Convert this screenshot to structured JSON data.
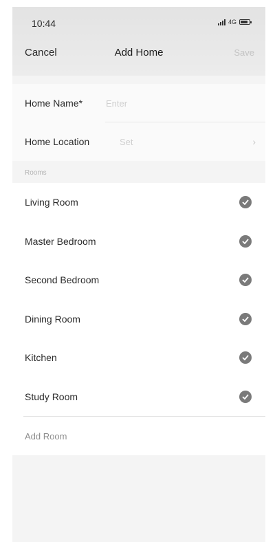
{
  "status_bar": {
    "time": "10:44",
    "network": "4G"
  },
  "nav": {
    "cancel_label": "Cancel",
    "title": "Add Home",
    "save_label": "Save"
  },
  "form": {
    "home_name_label": "Home Name*",
    "home_name_placeholder": "Enter",
    "home_location_label": "Home Location",
    "home_location_value": "Set"
  },
  "rooms": {
    "section_label": "Rooms",
    "items": [
      {
        "label": "Living Room",
        "checked": true
      },
      {
        "label": "Master Bedroom",
        "checked": true
      },
      {
        "label": "Second Bedroom",
        "checked": true
      },
      {
        "label": "Dining Room",
        "checked": true
      },
      {
        "label": "Kitchen",
        "checked": true
      },
      {
        "label": "Study Room",
        "checked": true
      }
    ],
    "add_room_label": "Add Room"
  },
  "colors": {
    "check_fill": "#7a7a7a",
    "placeholder": "#cfcfcf",
    "disabled_save": "#c4c4c4"
  }
}
